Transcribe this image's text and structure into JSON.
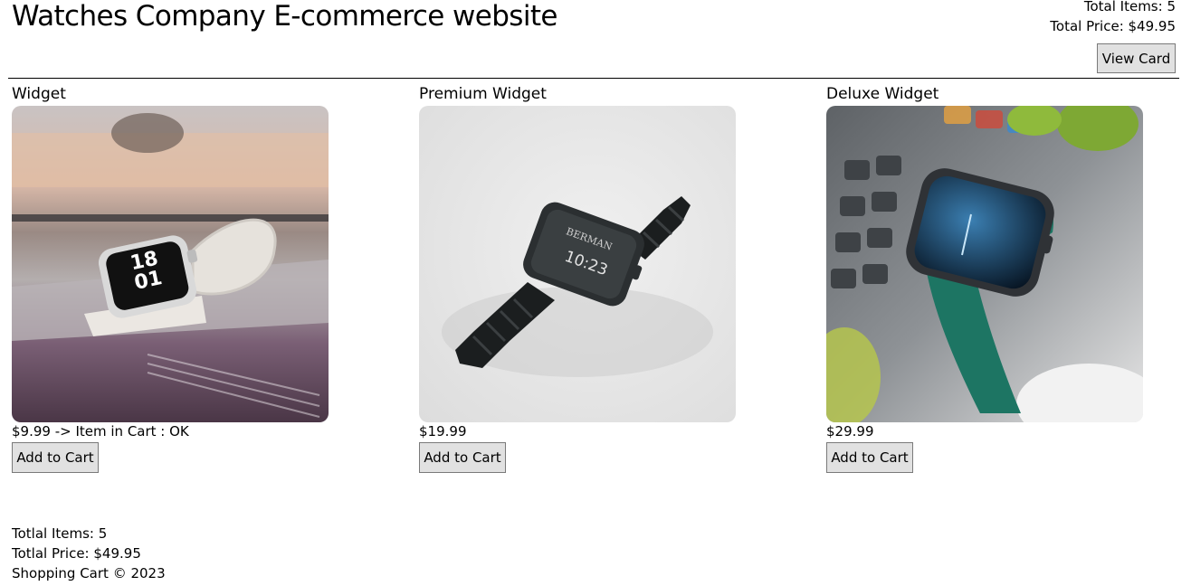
{
  "header": {
    "title": "Watches Company E-commerce website",
    "total_items": "Total Items: 5",
    "total_price": "Total Price: $49.95",
    "view_button": "View Card"
  },
  "products": [
    {
      "name": "Widget",
      "price": "$9.99 -> Item in Cart : OK",
      "button": "Add to Cart",
      "image_desc": "white-smartwatch-photo"
    },
    {
      "name": "Premium Widget",
      "price": "$19.99",
      "button": "Add to Cart",
      "image_desc": "black-smartwatch-photo"
    },
    {
      "name": "Deluxe Widget",
      "price": "$29.99",
      "button": "Add to Cart",
      "image_desc": "green-smartwatch-photo"
    }
  ],
  "footer": {
    "items": "Totlal Items: 5",
    "price": "Totlal Price: $49.95",
    "copyright": "Shopping Cart © 2023"
  }
}
